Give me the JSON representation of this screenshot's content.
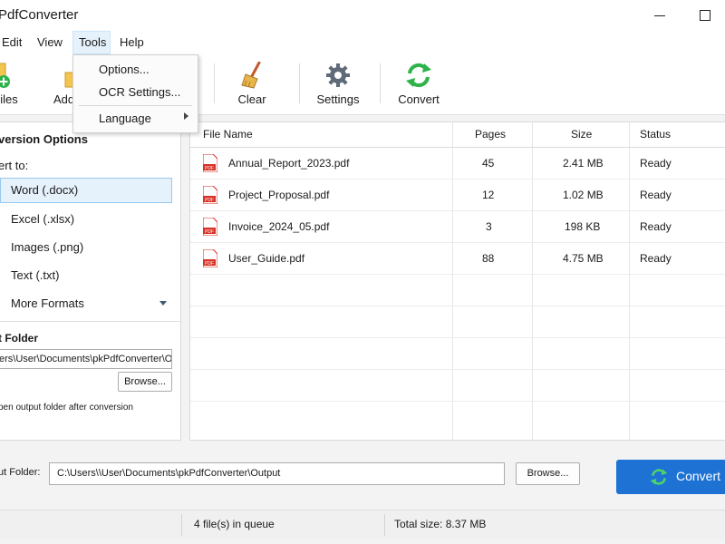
{
  "app": {
    "title": "PdfConverter"
  },
  "menu": {
    "edit": "Edit",
    "view": "View",
    "tools": "Tools",
    "help": "Help"
  },
  "toolbar": {
    "files_label": "Files",
    "add_label": "Add",
    "clear_label": "Clear",
    "settings_label": "Settings",
    "convert_label": "Convert"
  },
  "tools_dropdown": {
    "options": "Options...",
    "ocr_settings": "OCR Settings...",
    "language": "Language"
  },
  "left_panel": {
    "title": "version Options",
    "convert_to_label": "ert to:",
    "formats": [
      "Word (.docx)",
      "Excel (.xlsx)",
      "Images (.png)",
      "Text (.txt)",
      "More Formats"
    ],
    "selected_format": "Word (.docx)",
    "output_folder_label": "t Folder",
    "output_path": "ers\\User\\Documents\\pkPdfConverter\\Output",
    "browse_label": "Browse...",
    "open_after_label": "pen output folder after conversion"
  },
  "table": {
    "columns": [
      "File Name",
      "Pages",
      "Size",
      "Status"
    ],
    "rows": [
      {
        "name": "Annual_Report_2023.pdf",
        "pages": "45",
        "size": "2.41 MB",
        "status": "Ready"
      },
      {
        "name": "Project_Proposal.pdf",
        "pages": "12",
        "size": "1.02 MB",
        "status": "Ready"
      },
      {
        "name": "Invoice_2024_05.pdf",
        "pages": "3",
        "size": "198 KB",
        "status": "Ready"
      },
      {
        "name": "User_Guide.pdf",
        "pages": "88",
        "size": "4.75 MB",
        "status": "Ready"
      }
    ]
  },
  "bottom": {
    "output_folder_label": "ut Folder:",
    "output_path": "C:\\Users\\\\User\\Documents\\pkPdfConverter\\Output",
    "browse_label": "Browse...",
    "convert_label": "Convert"
  },
  "status": {
    "queue": "4 file(s) in queue",
    "total_size": "Total size: 8.37 MB"
  },
  "colors": {
    "accent": "#1d72d4",
    "selection_bg": "#e5f1fb",
    "pdf_red": "#d93025",
    "convert_green": "#2db34a"
  },
  "icons": [
    "add-files-icon",
    "add-folder-icon",
    "clear-broom-icon",
    "settings-gear-icon",
    "convert-arrows-icon",
    "pdf-file-icon",
    "chevron-down-icon",
    "submenu-arrow-icon"
  ]
}
